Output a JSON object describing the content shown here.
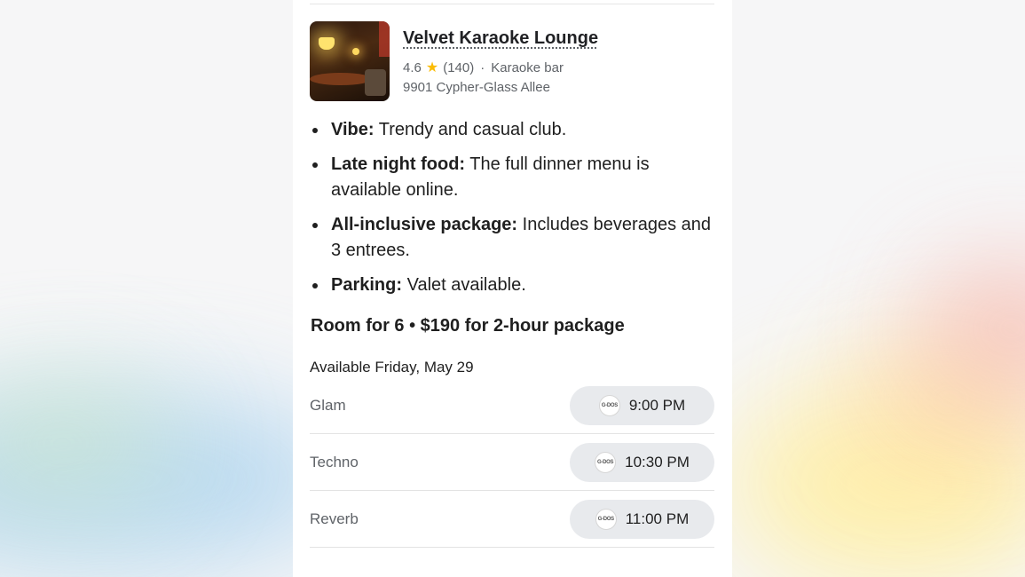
{
  "place": {
    "name": "Velvet Karaoke Lounge",
    "rating": "4.6",
    "review_count": "(140)",
    "separator": "·",
    "category": "Karaoke bar",
    "address": "9901 Cypher-Glass Allee",
    "star_color": "#fbbc04"
  },
  "details": [
    {
      "label": "Vibe:",
      "text": " Trendy and casual club."
    },
    {
      "label": "Late night food:",
      "text": " The full dinner menu is available online."
    },
    {
      "label": "All-inclusive package:",
      "text": " Includes beverages and 3 entrees."
    },
    {
      "label": "Parking:",
      "text": " Valet available."
    }
  ],
  "package": "Room for 6 • $190 for 2-hour package",
  "available": "Available Friday, May 29",
  "rooms": [
    {
      "name": "Glam",
      "time": "9:00 PM",
      "logo_text": "G-DOS"
    },
    {
      "name": "Techno",
      "time": "10:30 PM",
      "logo_text": "G-DOS"
    },
    {
      "name": "Reverb",
      "time": "11:00 PM",
      "logo_text": "G-DOS"
    }
  ],
  "colors": {
    "slot_background": "#e8eaed",
    "secondary_text": "#5f6368"
  }
}
